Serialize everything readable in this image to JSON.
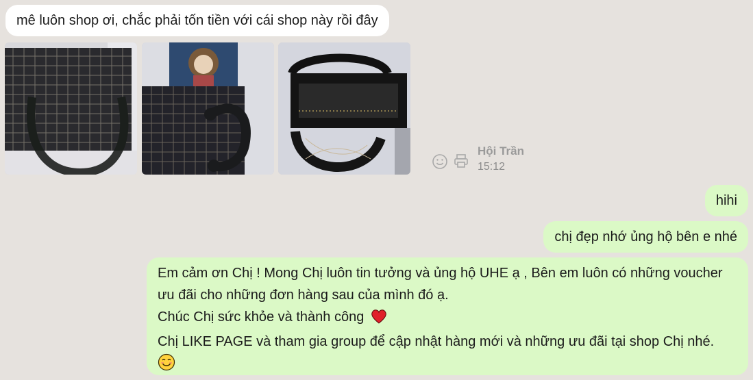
{
  "chat": {
    "incoming_message": "mê luôn shop ơi, chắc phải tốn tiền với cái shop này rồi đây",
    "photos": [
      {
        "subject": "black tweed handbag front"
      },
      {
        "subject": "black tweed handbag with card"
      },
      {
        "subject": "open black handbag interior"
      }
    ],
    "meta": {
      "react_icon": "smile-icon",
      "print_icon": "print-icon",
      "sender": "Hội Trần",
      "time": "15:12"
    },
    "outgoing_messages": [
      "hihi",
      "chị đẹp nhớ ủng hộ bên e nhé"
    ],
    "reply": {
      "line1": "Em cảm ơn Chị ! Mong Chị luôn tin tưởng và ủng hộ UHE ạ , Bên em luôn có những voucher",
      "line2": "ưu đãi cho những đơn hàng sau của mình đó ạ.",
      "line3": "Chúc Chị sức khỏe và thành công",
      "line3_emoji": "heart-icon",
      "line4": "Chị LIKE PAGE và tham gia group để cập nhật hàng mới và những ưu đãi tại shop Chị nhé.",
      "line5_emoji": "smiling-face-icon"
    }
  },
  "colors": {
    "background": "#e6e2de",
    "incoming_bubble": "#ffffff",
    "outgoing_bubble": "#dbf9c6",
    "meta_text": "#9a9a9a",
    "heart": "#e0202a"
  }
}
